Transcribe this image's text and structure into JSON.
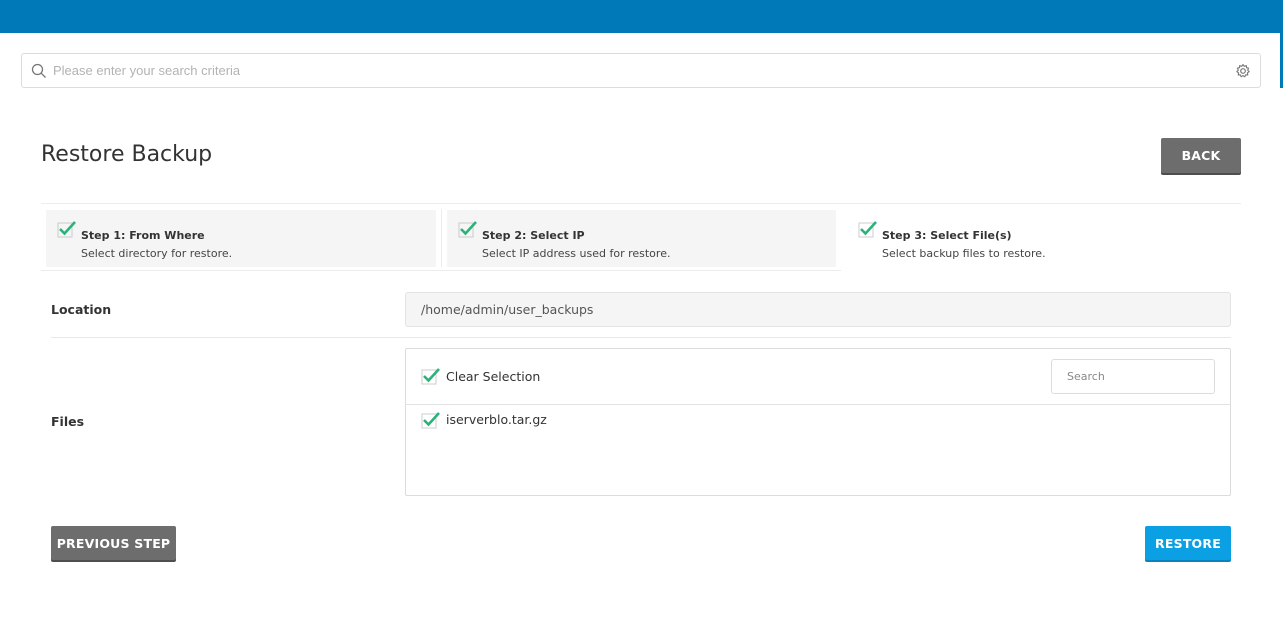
{
  "search": {
    "placeholder": "Please enter your search criteria"
  },
  "page": {
    "title": "Restore Backup",
    "back_label": "BACK"
  },
  "steps": [
    {
      "title": "Step 1: From Where",
      "desc": "Select directory for restore."
    },
    {
      "title": "Step 2: Select IP",
      "desc": "Select IP address used for restore."
    },
    {
      "title": "Step 3: Select File(s)",
      "desc": "Select backup files to restore."
    }
  ],
  "form": {
    "location_label": "Location",
    "location_value": "/home/admin/user_backups",
    "files_label": "Files",
    "clear_selection_label": "Clear Selection",
    "files_search_placeholder": "Search",
    "files": [
      {
        "name": "iserverblo.tar.gz",
        "checked": true
      }
    ]
  },
  "actions": {
    "previous_label": "PREVIOUS STEP",
    "restore_label": "RESTORE"
  },
  "colors": {
    "topbar": "#0079b8",
    "check": "#2ab27b",
    "restore_button": "#0aa0e3",
    "gray_button": "#6d6d6d"
  }
}
